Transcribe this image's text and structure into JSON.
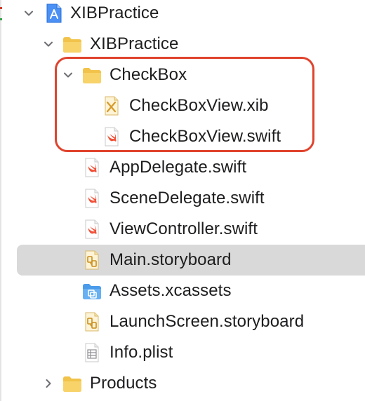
{
  "navigator": {
    "project": {
      "label": "XIBPractice",
      "icon": "xcode-project-icon"
    },
    "group": {
      "label": "XIBPractice",
      "icon": "folder-icon"
    },
    "checkbox_folder": {
      "label": "CheckBox",
      "icon": "folder-icon"
    },
    "files": [
      {
        "label": "CheckBoxView.xib",
        "icon": "xib-file-icon"
      },
      {
        "label": "CheckBoxView.swift",
        "icon": "swift-file-icon"
      },
      {
        "label": "AppDelegate.swift",
        "icon": "swift-file-icon"
      },
      {
        "label": "SceneDelegate.swift",
        "icon": "swift-file-icon"
      },
      {
        "label": "ViewController.swift",
        "icon": "swift-file-icon"
      },
      {
        "label": "Main.storyboard",
        "icon": "storyboard-file-icon",
        "selected": true
      },
      {
        "label": "Assets.xcassets",
        "icon": "asset-catalog-icon"
      },
      {
        "label": "LaunchScreen.storyboard",
        "icon": "storyboard-file-icon"
      },
      {
        "label": "Info.plist",
        "icon": "plist-file-icon"
      }
    ],
    "products": {
      "label": "Products",
      "icon": "folder-icon"
    }
  },
  "colors": {
    "folder": "#f2c34a",
    "swift": "#f05138",
    "selection": "#d9d9d9",
    "highlight": "#e0432d",
    "project": "#2f7cf6"
  }
}
